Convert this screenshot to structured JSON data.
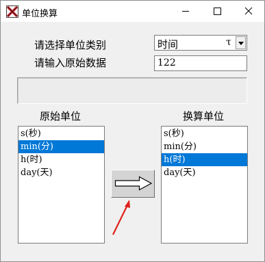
{
  "window": {
    "title": "单位换算"
  },
  "form": {
    "category_label": "请选择单位类别",
    "input_label": "请输入原始数据",
    "category_value": "时间",
    "category_suffix": "τ",
    "input_value": "122",
    "result_text": ""
  },
  "lists": {
    "source_label": "原始单位",
    "target_label": "换算单位",
    "source_items": [
      "s(秒)",
      "min(分)",
      "h(时)",
      "day(天)"
    ],
    "source_selected": "min(分)",
    "target_items": [
      "s(秒)",
      "min(分)",
      "h(时)",
      "day(天)"
    ],
    "target_selected": "h(时)"
  },
  "colors": {
    "selection": "#0078d7",
    "annotation_arrow": "#e0201b"
  }
}
